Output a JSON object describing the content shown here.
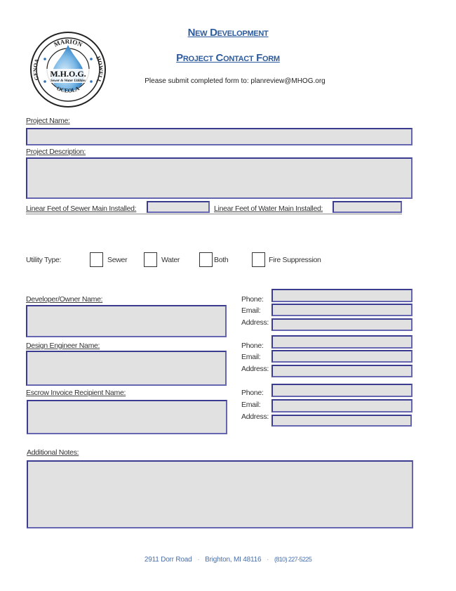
{
  "header": {
    "title_line1": "New Development",
    "title_line2": "Project Contact Form",
    "submit_note": "Please submit completed form to: planreview@MHOG.org",
    "title_color": "#2c5a9c"
  },
  "logo": {
    "name": "M.H.O.G.",
    "tagline": "Sewer & Water Utilities",
    "ring_top": "MARION",
    "ring_bottom": "OCEOLA",
    "ring_left": "GENOA",
    "ring_right": "HOWELL"
  },
  "fields": {
    "project_name": {
      "label": "Project Name:",
      "value": ""
    },
    "project_description": {
      "label": "Project Description:",
      "value": ""
    },
    "sewer_feet": {
      "label": "Linear Feet of Sewer Main Installed:",
      "value": ""
    },
    "water_feet": {
      "label": "Linear Feet of Water Main Installed:",
      "value": ""
    }
  },
  "utility_type": {
    "label": "Utility Type:",
    "options": [
      {
        "label": "Sewer",
        "checked": false
      },
      {
        "label": "Water",
        "checked": false
      },
      {
        "label": "Both",
        "checked": false
      },
      {
        "label": "Fire Suppression",
        "checked": false
      }
    ]
  },
  "contacts": [
    {
      "name_label": "Developer/Owner Name:",
      "phone_label": "Phone:",
      "email_label": "Email:",
      "address_label": "Address:",
      "name": "",
      "phone": "",
      "email": "",
      "address": ""
    },
    {
      "name_label": "Design Engineer Name:",
      "phone_label": "Phone:",
      "email_label": "Email:",
      "address_label": "Address:",
      "name": "",
      "phone": "",
      "email": "",
      "address": ""
    },
    {
      "name_label": "Escrow Invoice Recipient Name:",
      "phone_label": "Phone:",
      "email_label": "Email:",
      "address_label": "Address:",
      "name": "",
      "phone": "",
      "email": "",
      "address": ""
    }
  ],
  "notes": {
    "label": "Additional Notes:",
    "value": ""
  },
  "footer": {
    "address": "2911 Dorr Road",
    "city": "Brighton, MI 48116",
    "phone": "(810) 227-5225",
    "separator": "·"
  },
  "colors": {
    "field_fill": "#e1e1e1",
    "field_border": "#3b3b8f",
    "footer_text": "#4a6fa8"
  }
}
